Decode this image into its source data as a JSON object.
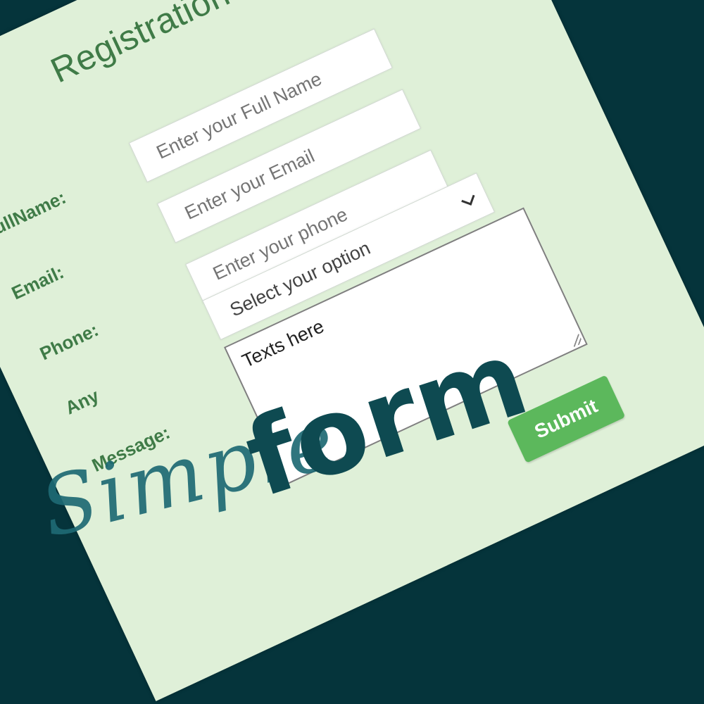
{
  "form": {
    "title": "Registration Form",
    "fields": [
      {
        "label": "FullName:",
        "placeholder": "Enter your Full Name"
      },
      {
        "label": "Email:",
        "placeholder": "Enter your Email"
      },
      {
        "label": "Phone:",
        "placeholder": "Enter your phone"
      }
    ],
    "select": {
      "label": "Any",
      "value": "Select your option"
    },
    "message": {
      "label": "Message:",
      "value": "Texts here"
    },
    "submit_label": "Submit"
  },
  "overlay": {
    "script_word": "Simple",
    "bold_word": "form"
  },
  "colors": {
    "background": "#05343b",
    "card": "#dff0d8",
    "label_green": "#3f7b47",
    "submit_green": "#5cb85c"
  }
}
